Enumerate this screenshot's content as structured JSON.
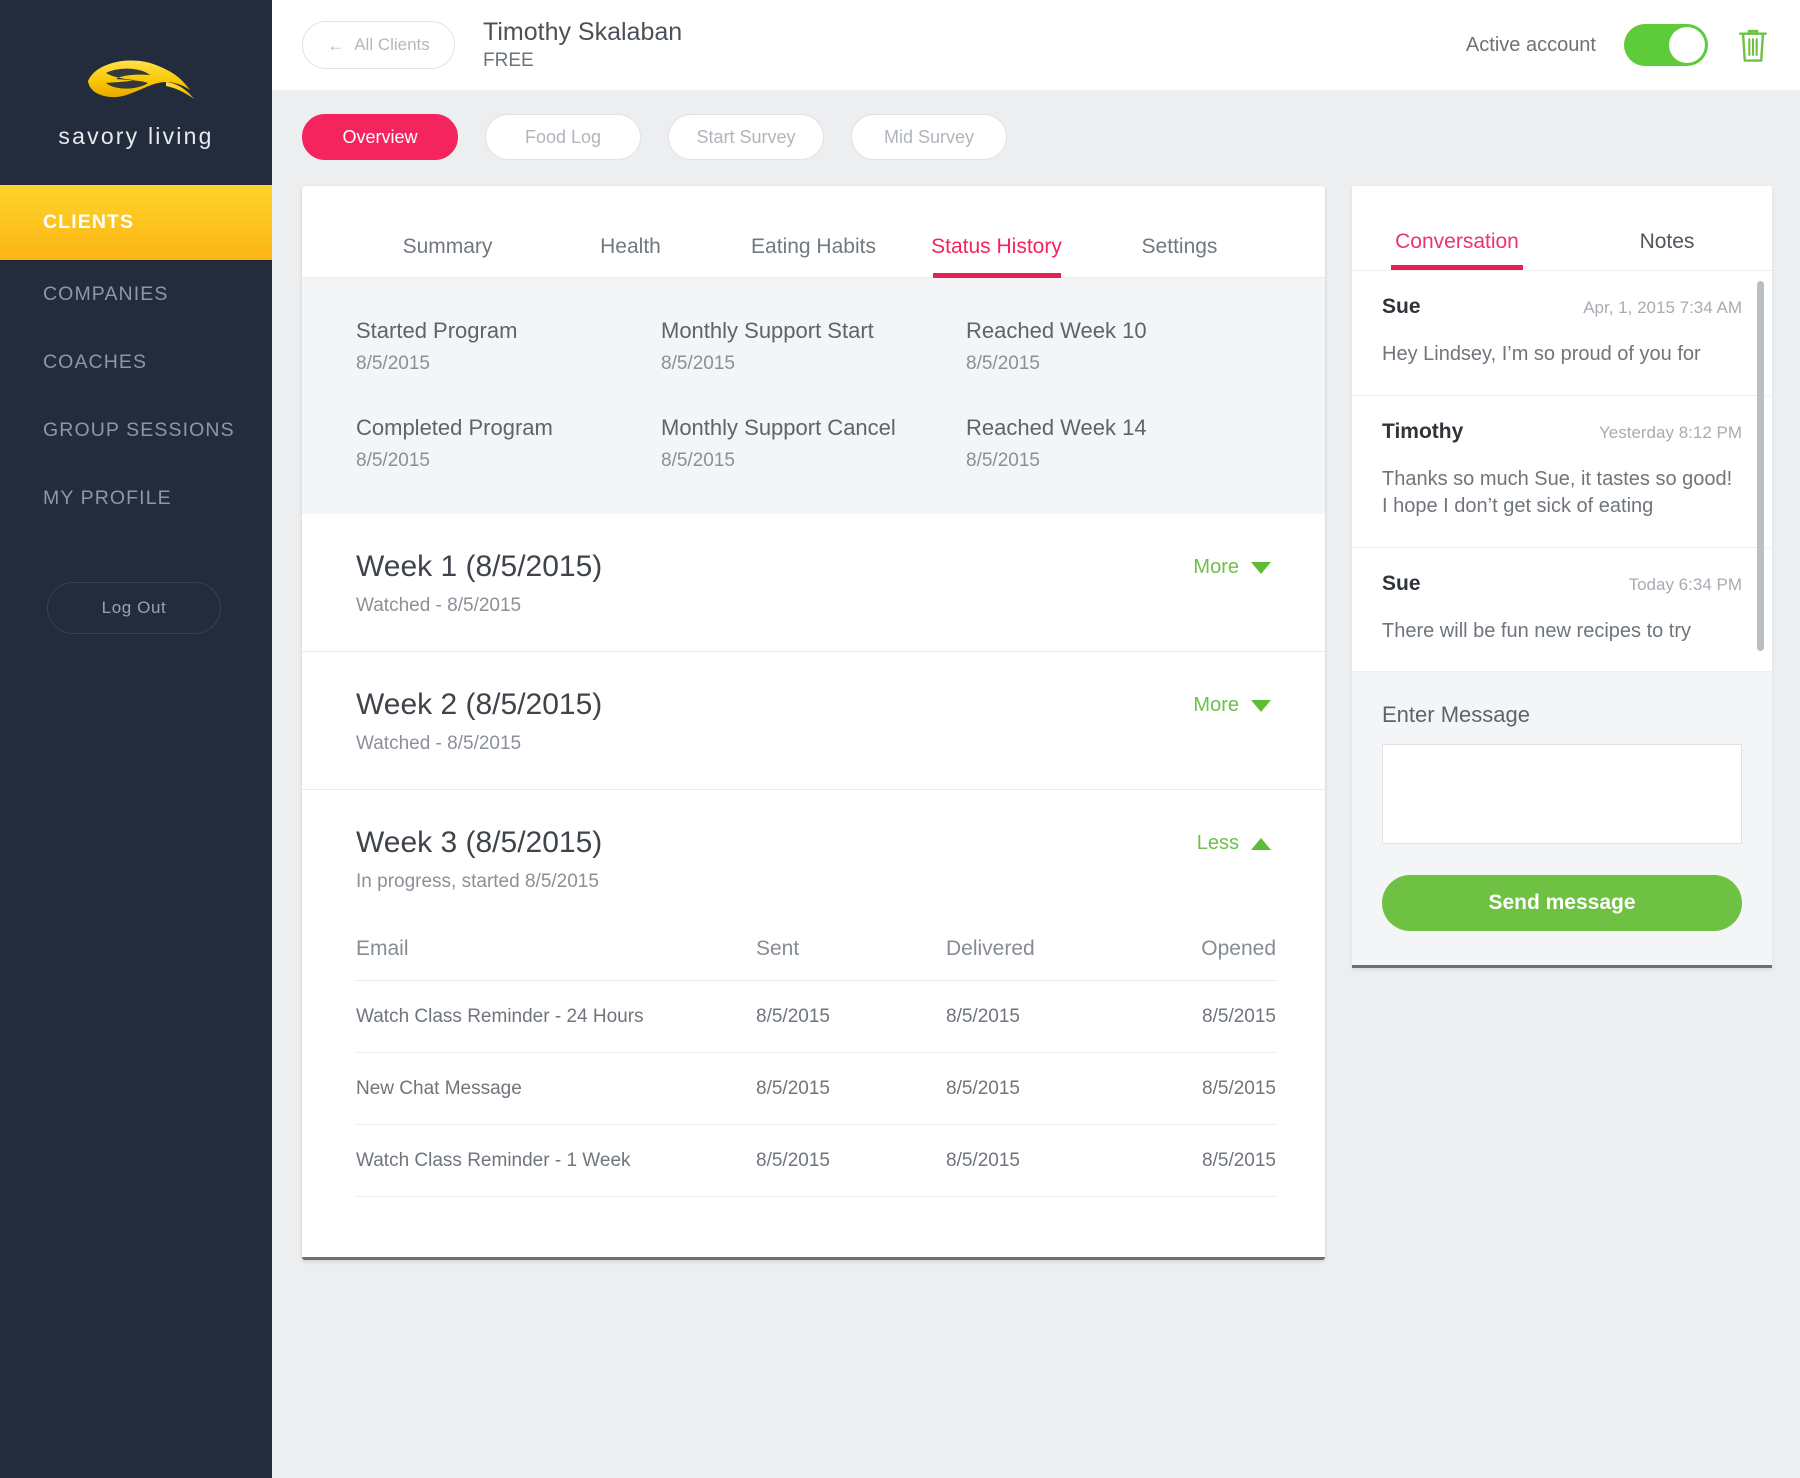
{
  "sidebar": {
    "logo_text": "savory living",
    "logo_icon": "leaf-swirl-logo",
    "items": [
      {
        "label": "CLIENTS",
        "active": true
      },
      {
        "label": "COMPANIES",
        "active": false
      },
      {
        "label": "COACHES",
        "active": false
      },
      {
        "label": "GROUP SESSIONS",
        "active": false
      },
      {
        "label": "MY PROFILE",
        "active": false
      }
    ],
    "logout_label": "Log Out"
  },
  "topbar": {
    "back_label": "All Clients",
    "back_icon": "arrow-left-icon",
    "client_name": "Timothy Skalaban",
    "client_plan": "FREE",
    "active_account_label": "Active account",
    "toggle_state": "on",
    "delete_icon": "trash-icon",
    "accent_green": "#5ecb3b"
  },
  "pills": [
    {
      "label": "Overview",
      "active": true
    },
    {
      "label": "Food Log",
      "active": false
    },
    {
      "label": "Start Survey",
      "active": false
    },
    {
      "label": "Mid Survey",
      "active": false
    }
  ],
  "inner_tabs": [
    {
      "label": "Summary",
      "active": false
    },
    {
      "label": "Health",
      "active": false
    },
    {
      "label": "Eating Habits",
      "active": false
    },
    {
      "label": "Status History",
      "active": true
    },
    {
      "label": "Settings",
      "active": false
    }
  ],
  "status_history": [
    {
      "label": "Started Program",
      "date": "8/5/2015"
    },
    {
      "label": "Monthly Support Start",
      "date": "8/5/2015"
    },
    {
      "label": "Reached Week 10",
      "date": "8/5/2015"
    },
    {
      "label": "Completed Program",
      "date": "8/5/2015"
    },
    {
      "label": "Monthly Support Cancel",
      "date": "8/5/2015"
    },
    {
      "label": "Reached Week 14",
      "date": "8/5/2015"
    }
  ],
  "weeks": [
    {
      "title": "Week 1 (8/5/2015)",
      "subtitle": "Watched - 8/5/2015",
      "toggle_label": "More",
      "expanded": false
    },
    {
      "title": "Week 2 (8/5/2015)",
      "subtitle": "Watched - 8/5/2015",
      "toggle_label": "More",
      "expanded": false
    },
    {
      "title": "Week 3 (8/5/2015)",
      "subtitle": "In progress, started 8/5/2015",
      "toggle_label": "Less",
      "expanded": true
    }
  ],
  "email_table": {
    "headers": [
      "Email",
      "Sent",
      "Delivered",
      "Opened"
    ],
    "rows": [
      [
        "Watch Class Reminder - 24 Hours",
        "8/5/2015",
        "8/5/2015",
        "8/5/2015"
      ],
      [
        "New Chat Message",
        "8/5/2015",
        "8/5/2015",
        "8/5/2015"
      ],
      [
        "Watch Class Reminder - 1 Week",
        "8/5/2015",
        "8/5/2015",
        "8/5/2015"
      ]
    ]
  },
  "chat": {
    "tabs": [
      {
        "label": "Conversation",
        "active": true
      },
      {
        "label": "Notes",
        "active": false
      }
    ],
    "messages": [
      {
        "author": "Sue",
        "time": "Apr, 1, 2015 7:34 AM",
        "body": "Hey Lindsey, I’m so proud of you for"
      },
      {
        "author": "Timothy",
        "time": "Yesterday 8:12 PM",
        "body": "Thanks so much Sue, it tastes so good! I hope I don’t get sick of eating"
      },
      {
        "author": "Sue",
        "time": "Today 6:34 PM",
        "body": "There will be fun new recipes to try"
      }
    ],
    "compose_label": "Enter Message",
    "compose_value": "",
    "compose_placeholder": "",
    "send_label": "Send message"
  }
}
